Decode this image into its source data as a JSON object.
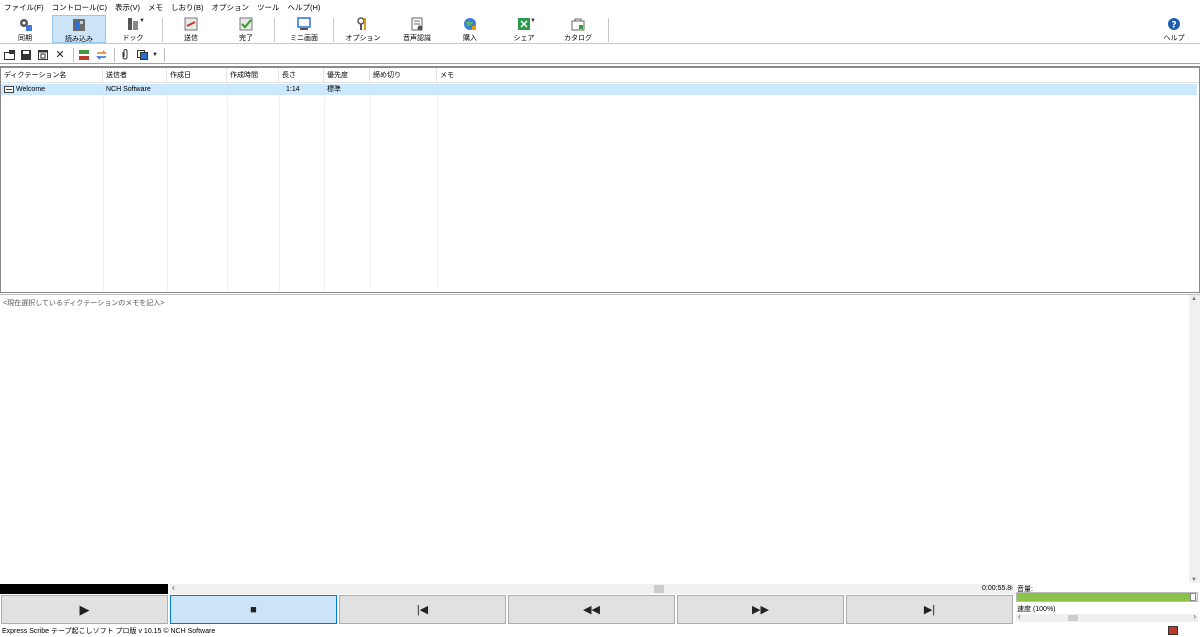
{
  "menubar": {
    "items": [
      "ファイル(F)",
      "コントロール(C)",
      "表示(V)",
      "メモ",
      "しおり(B)",
      "オプション",
      "ツール",
      "ヘルプ(H)"
    ]
  },
  "toolbar": {
    "buttons": [
      {
        "label": "同期",
        "icon": "sync-gear-icon"
      },
      {
        "label": "読み込み",
        "icon": "load-icon",
        "active": true
      },
      {
        "label": "ドック",
        "icon": "dock-icon"
      },
      {
        "label": "送信",
        "icon": "send-icon"
      },
      {
        "label": "完了",
        "icon": "done-check-icon"
      },
      {
        "label": "ミニ画面",
        "icon": "mini-screen-icon"
      },
      {
        "label": "オプション",
        "icon": "options-tools-icon"
      },
      {
        "label": "音声認識",
        "icon": "speech-recognition-icon"
      },
      {
        "label": "購入",
        "icon": "buy-globe-icon"
      },
      {
        "label": "シェア",
        "icon": "share-icon"
      },
      {
        "label": "カタログ",
        "icon": "catalog-icon"
      },
      {
        "label": "ヘルプ",
        "icon": "help-icon"
      }
    ]
  },
  "toolbar2": {
    "icons": [
      "open-icon",
      "save-icon",
      "new-window-icon",
      "delete-icon",
      "tree-icon",
      "convert-icon",
      "attach-icon",
      "copy-icon"
    ]
  },
  "list": {
    "columns": [
      "ディクテーション名",
      "送信者",
      "作成日",
      "作成時間",
      "長さ",
      "優先度",
      "締め切り",
      "メモ"
    ],
    "rows": [
      {
        "name": "Welcome",
        "sender": "NCH Software",
        "date": "",
        "time": "",
        "length": "1:14",
        "priority": "標準",
        "deadline": "",
        "memo": ""
      }
    ]
  },
  "memo": {
    "placeholder": "<現在選択しているディクテーションのメモを記入>"
  },
  "transport": {
    "time": "0:00:55.8",
    "buttons": [
      {
        "icon": "play-icon",
        "glyph": "▶"
      },
      {
        "icon": "stop-icon",
        "glyph": "■",
        "active": true
      },
      {
        "icon": "skip-start-icon",
        "glyph": "|◀"
      },
      {
        "icon": "rewind-icon",
        "glyph": "◀◀"
      },
      {
        "icon": "fast-forward-icon",
        "glyph": "▶▶"
      },
      {
        "icon": "skip-end-icon",
        "glyph": "▶|"
      }
    ],
    "volume_label": "音量:",
    "volume_level": 0.97,
    "speed_label": "速度 (100%)"
  },
  "status": {
    "text": "Express Scribe テープ起こしソフト プロ版 v 10.15 © NCH Software"
  },
  "colors": {
    "selection": "#cce8ff",
    "active_button": "#cce4f7",
    "volume_fill": "#8bc34a"
  }
}
